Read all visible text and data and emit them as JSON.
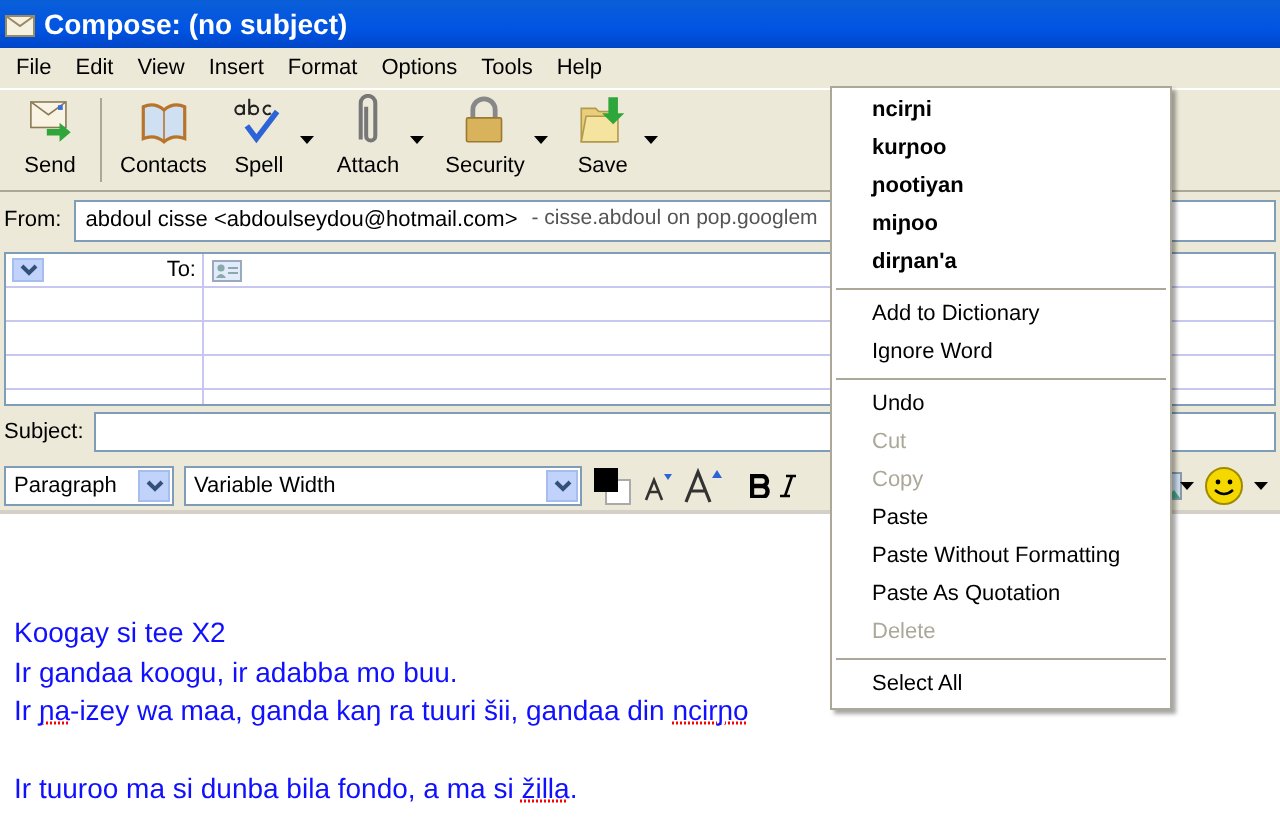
{
  "window": {
    "title": "Compose: (no subject)"
  },
  "menu_bar": [
    {
      "label": "File"
    },
    {
      "label": "Edit"
    },
    {
      "label": "View"
    },
    {
      "label": "Insert"
    },
    {
      "label": "Format"
    },
    {
      "label": "Options"
    },
    {
      "label": "Tools"
    },
    {
      "label": "Help"
    }
  ],
  "toolbar": [
    {
      "label": "Send",
      "kind": "send",
      "dropdown": false
    },
    {
      "label": "Contacts",
      "kind": "contacts",
      "dropdown": false
    },
    {
      "label": "Spell",
      "kind": "spell",
      "dropdown": true
    },
    {
      "label": "Attach",
      "kind": "attach",
      "dropdown": true
    },
    {
      "label": "Security",
      "kind": "security",
      "dropdown": true
    },
    {
      "label": "Save",
      "kind": "save",
      "dropdown": true
    }
  ],
  "from": {
    "label": "From:",
    "value": "abdoul cisse <abdoulseydou@hotmail.com>",
    "account": "- cisse.abdoul on pop.googlem"
  },
  "recipients": [
    {
      "type": "To:"
    }
  ],
  "subject": {
    "label": "Subject:"
  },
  "format_bar": {
    "paragraph": "Paragraph",
    "font": "Variable Width"
  },
  "body": {
    "paragraphs": [
      {
        "lines": [
          [
            {
              "text": "Koogay si tee X2",
              "misspelled": false
            }
          ],
          [
            {
              "text": "Ir gandaa koogu, ir adabba mo buu.",
              "misspelled": false
            }
          ],
          [
            {
              "text": "Ir ",
              "misspelled": false
            },
            {
              "text": "ɲa",
              "misspelled": true
            },
            {
              "text": "-izey wa maa, ganda kaŋ ra tuuri šii, gandaa din ",
              "misspelled": false
            },
            {
              "text": "ncirɲo",
              "misspelled": true
            }
          ]
        ]
      },
      {
        "lines": [
          [
            {
              "text": "Ir tuuroo ma si dunba bila fondo, a ma si ",
              "misspelled": false
            },
            {
              "text": "žilla",
              "misspelled": true
            },
            {
              "text": ".",
              "misspelled": false
            }
          ]
        ]
      }
    ]
  },
  "context_menu": {
    "groups": [
      [
        {
          "label": "ncirɲi",
          "kind": "suggestion",
          "disabled": false
        },
        {
          "label": "kurɲoo",
          "kind": "suggestion",
          "disabled": false
        },
        {
          "label": "ɲootiyan",
          "kind": "suggestion",
          "disabled": false
        },
        {
          "label": "miɲoo",
          "kind": "suggestion",
          "disabled": false
        },
        {
          "label": "dirɲan'a",
          "kind": "suggestion",
          "disabled": false
        }
      ],
      [
        {
          "label": "Add to Dictionary",
          "kind": "command",
          "disabled": false
        },
        {
          "label": "Ignore Word",
          "kind": "command",
          "disabled": false
        }
      ],
      [
        {
          "label": "Undo",
          "kind": "command",
          "disabled": false
        },
        {
          "label": "Cut",
          "kind": "command",
          "disabled": true
        },
        {
          "label": "Copy",
          "kind": "command",
          "disabled": true
        },
        {
          "label": "Paste",
          "kind": "command",
          "disabled": false
        },
        {
          "label": "Paste Without Formatting",
          "kind": "command",
          "disabled": false
        },
        {
          "label": "Paste As Quotation",
          "kind": "command",
          "disabled": false
        },
        {
          "label": "Delete",
          "kind": "command",
          "disabled": true
        }
      ],
      [
        {
          "label": "Select All",
          "kind": "command",
          "disabled": false
        }
      ]
    ]
  }
}
